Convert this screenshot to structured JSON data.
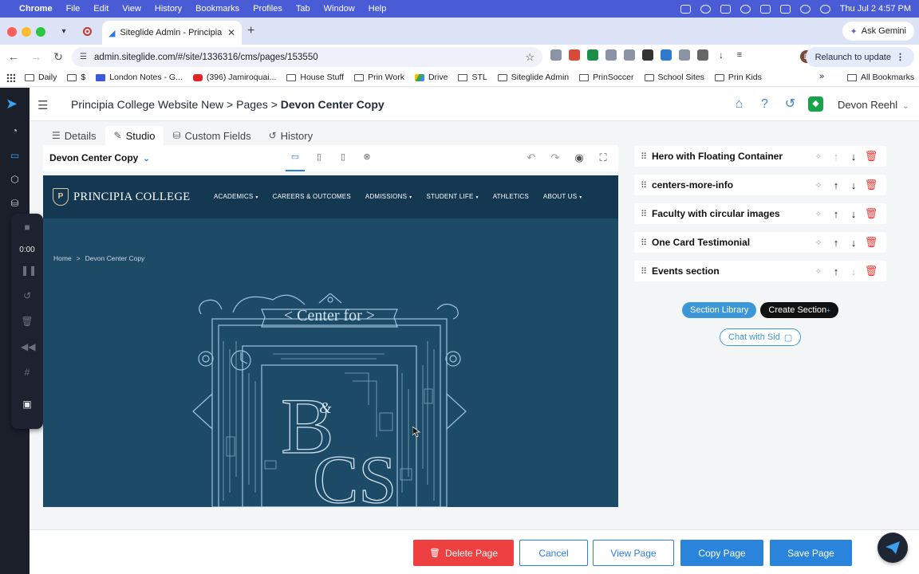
{
  "mac_menu": {
    "app_name": "Chrome",
    "items": [
      "File",
      "Edit",
      "View",
      "History",
      "Bookmarks",
      "Profiles",
      "Tab",
      "Window",
      "Help"
    ],
    "datetime": "Thu Jul 2  4:57 PM"
  },
  "browser": {
    "tab_title": "Siteglide Admin - Principia C",
    "url": "admin.siteglide.com/#/site/1336316/cms/pages/153550",
    "ask_gemini": "Ask Gemini",
    "relaunch": "Relaunch to update",
    "profile_initial": "D",
    "bookmarks": [
      "Daily",
      "$",
      "London Notes - G...",
      "(396) Jamiroquai...",
      "House Stuff",
      "Prin Work",
      "Drive",
      "STL",
      "Siteglide Admin",
      "PrinSoccer",
      "School Sites",
      "Prin Kids"
    ],
    "all_bookmarks": "All Bookmarks"
  },
  "header": {
    "breadcrumb_prefix": "Principia College Website New > Pages > ",
    "breadcrumb_current": "Devon Center Copy",
    "user_name": "Devon Reehl"
  },
  "recorder": {
    "timer": "0:00"
  },
  "tabs": [
    {
      "label": "Details"
    },
    {
      "label": "Studio"
    },
    {
      "label": "Custom Fields"
    },
    {
      "label": "History"
    }
  ],
  "studio": {
    "page_select": "Devon Center Copy"
  },
  "preview": {
    "logo_text": "PRINCIPIA COLLEGE",
    "logo_mark": "P",
    "menu": [
      "ACADEMICS",
      "CAREERS & OUTCOMES",
      "ADMISSIONS",
      "STUDENT LIFE",
      "ATHLETICS",
      "ABOUT US"
    ],
    "crumb_home": "Home",
    "crumb_sep": ">",
    "crumb_current": "Devon Center Copy",
    "hero_title": "< Center for >",
    "hero_b": "B",
    "hero_amp": "&",
    "hero_cs": "CS"
  },
  "sections": [
    {
      "label": "Hero with Floating Container"
    },
    {
      "label": "centers-more-info"
    },
    {
      "label": "Faculty with circular images"
    },
    {
      "label": "One Card Testimonial"
    },
    {
      "label": "Events section"
    }
  ],
  "section_actions": {
    "library": "Section Library",
    "create": "Create Section",
    "create_mark": "+",
    "chat": "Chat with Sid"
  },
  "footer": {
    "delete": "Delete Page",
    "cancel": "Cancel",
    "view": "View Page",
    "copy": "Copy Page",
    "save": "Save Page"
  },
  "colors": {
    "mac_bar": "#4a5bd6",
    "sidebar": "#1b1f2a",
    "preview_bg": "#1d4a66",
    "preview_nav": "#143752",
    "accent": "#2a84dc",
    "danger": "#ee4040"
  }
}
